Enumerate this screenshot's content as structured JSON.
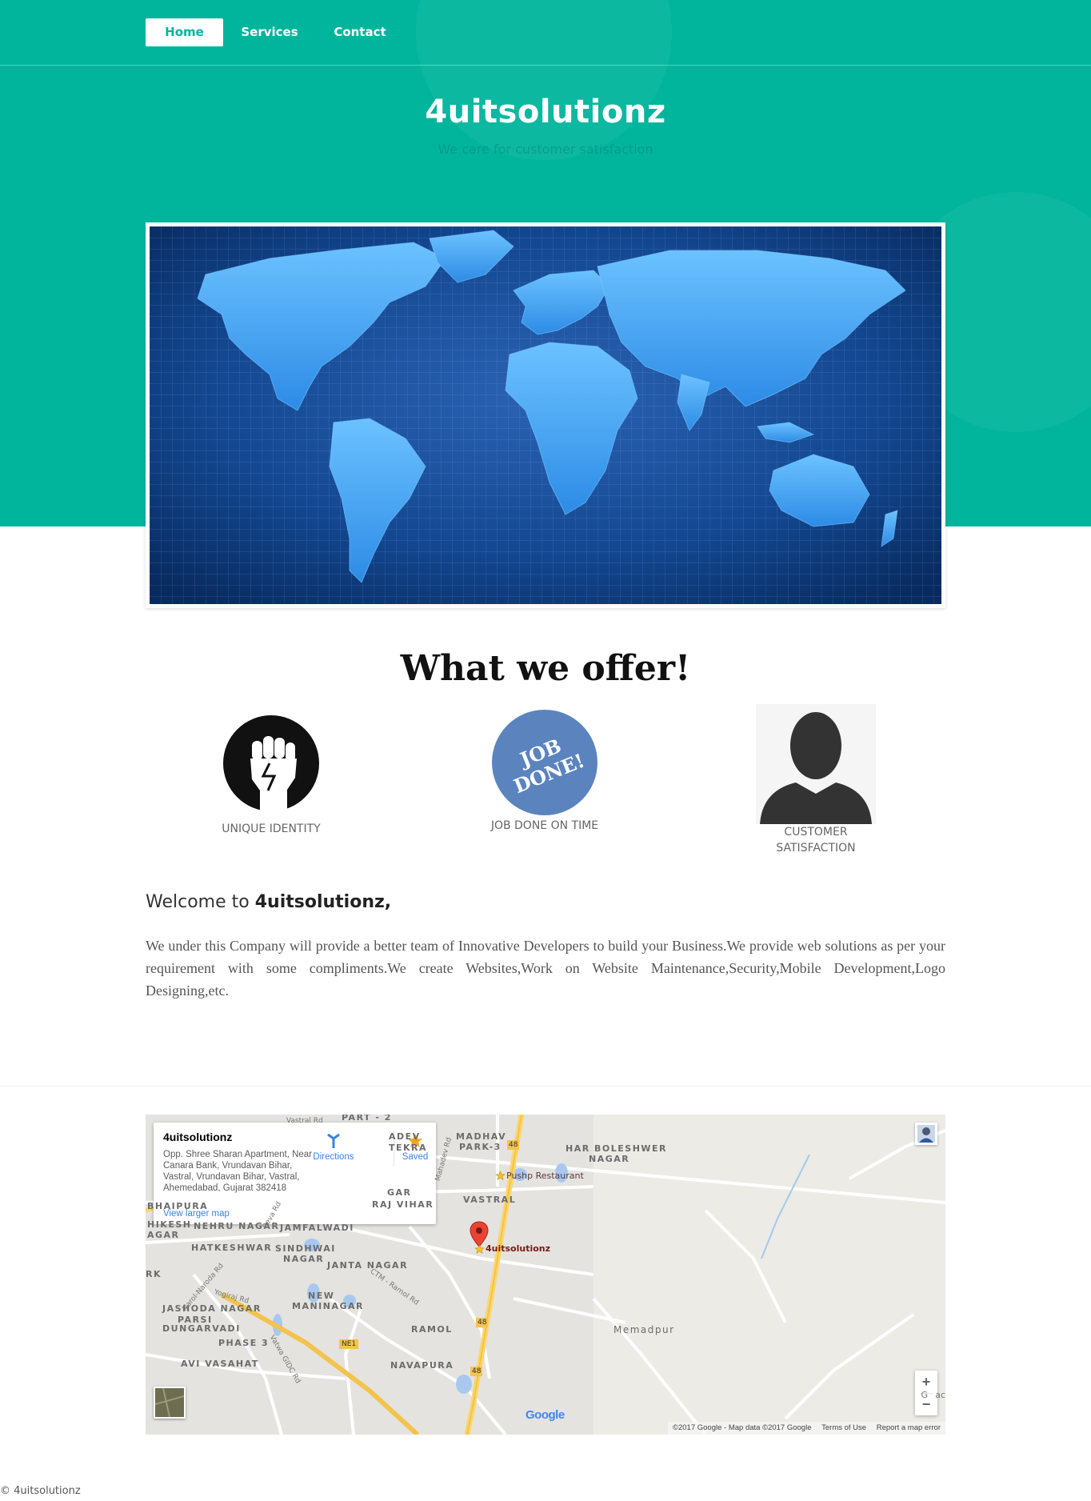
{
  "nav": {
    "items": [
      {
        "label": "Home",
        "active": true
      },
      {
        "label": "Services",
        "active": false
      },
      {
        "label": "Contact",
        "active": false
      }
    ]
  },
  "hero": {
    "title": "4uitsolutionz",
    "subtitle": "We care for customer satisfaction",
    "banner_icon": "world-map-image"
  },
  "offer": {
    "title": "What we offer!",
    "features": [
      {
        "icon": "raised-fist-icon",
        "label": "UNIQUE IDENTITY"
      },
      {
        "icon": "job-done-stamp-icon",
        "label": "JOB DONE ON TIME",
        "stamp_text": [
          "JOB",
          "DONE!"
        ]
      },
      {
        "icon": "person-silhouette-icon",
        "label_lines": [
          "CUSTOMER",
          "SATISFACTION"
        ]
      }
    ]
  },
  "welcome": {
    "prefix": "Welcome to",
    "name": "4uitsolutionz,",
    "body": "We under this Company will provide a better team of Innovative Developers to build your Business.We provide web solutions as per your requirement with some compliments.We create Websites,Work on Website Maintenance,Security,Mobile Development,Logo Designing,etc."
  },
  "map": {
    "place": {
      "name": "4uitsolutionz",
      "address": "Opp. Shree Sharan Apartment, Near Canara Bank, Vrundavan Bihar, Vastral, Vrundavan Bihar, Vastral, Ahemedabad, Gujarat 382418",
      "directions_label": "Directions",
      "saved_label": "Saved",
      "larger_map_label": "View larger map"
    },
    "labels": {
      "part2": "PART - 2",
      "vastral_rd": "Vastral Rd",
      "adev": "ADEV",
      "tekra": "TEKRA",
      "madhav1": "MADHAV",
      "madhav2": "PARK-3",
      "harbol1": "HAR BOLESHWER",
      "harbol2": "NAGAR",
      "pushp": "Pushp Restaurant",
      "gar": "GAR",
      "vihar": "RAJ VIHAR",
      "vastral": "VASTRAL",
      "bhaipura": "BHAIPURA",
      "hikesh1": "HIKESH",
      "hikesh2": "AGAR",
      "nehru": "NEHRU NAGAR",
      "jamfal": "JAMFALWADI",
      "marker": "4uitsolutionz",
      "hatkeshwar": "HATKESHWAR",
      "sindh1": "SINDHWAI",
      "sindh2": "NAGAR",
      "janta": "JANTA NAGAR",
      "rk": "RK",
      "new1": "NEW",
      "new2": "MANINAGAR",
      "jashoda": "JASHODA NAGAR",
      "parsi1": "PARSI",
      "parsi2": "DUNGARVADI",
      "phase3": "PHASE 3",
      "ramol": "RAMOL",
      "memadpur": "Memadpur",
      "avi": "AVI VASAHAT",
      "navapura": "NAVAPURA",
      "narol_rd": "Narol-Naroda Rd",
      "yogiraj": "Yogiraj Rd",
      "ctm": "CTM - Ramol Rd",
      "mahadev": "Mahadev Rd",
      "vatwa": "Vatwa GIDC Rd",
      "reva": "Reva Rd",
      "sh48a": "48",
      "sh48b": "48",
      "sh48c": "48",
      "ne1": "NE1",
      "gc": "G",
      "gac": "ac"
    },
    "zoom_in": "+",
    "zoom_out": "−",
    "google": "Google",
    "attribution": "©2017 Google - Map data ©2017 Google",
    "terms": "Terms of Use",
    "report": "Report a map error"
  },
  "footer": {
    "text": "© 4uitsolutionz"
  },
  "colors": {
    "brand": "#00b59c",
    "map_link": "#3a84df",
    "job_badge": "#5b84bf"
  }
}
